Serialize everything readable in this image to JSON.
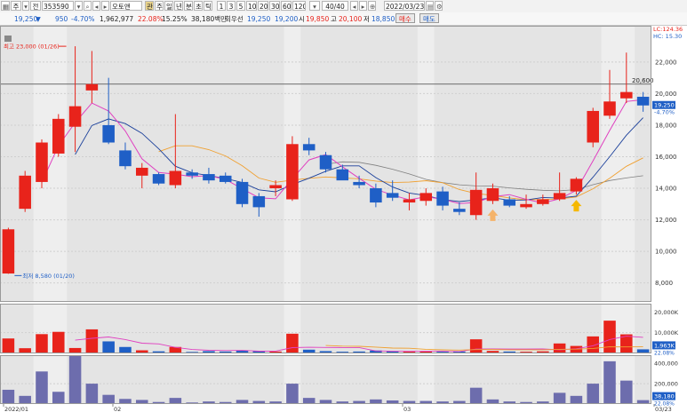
{
  "toolbar": {
    "mode1": "주",
    "mode2": "전",
    "code": "353590",
    "name": "오토앤",
    "tags": [
      "관",
      "주",
      "일",
      "년",
      "분",
      "초",
      "틱"
    ],
    "intervals": [
      "1",
      "3",
      "5",
      "10",
      "20",
      "30",
      "60",
      "120"
    ],
    "count": "40/40",
    "date": "2022/03/23"
  },
  "infobar": {
    "price": "19,250",
    "change": "950",
    "change_pct": "-4.70%",
    "volume": "1,962,977",
    "vol_ratio": "22.08%",
    "turnover": "15.25%",
    "amount": "38,180백만",
    "right_label": "회우선",
    "prev_price": "19,250",
    "prev2": "19,200",
    "open_label": "시",
    "open": "19,850",
    "high_label": "고",
    "high": "20,100",
    "low_label": "저",
    "low": "18,850",
    "buy": "매수",
    "sell": "매도"
  },
  "annotations": {
    "high_marker": "최고 23,000 (01/26)",
    "low_marker": "최저 8,580 (01/20)",
    "ref_line": "20,600",
    "legend1": "LC:124.36",
    "legend2": "HC: 15.30",
    "price_tag": "19,250",
    "price_pct": "-4.70%",
    "vol_tag": "1,963K",
    "vol_pct": "22.08%",
    "amt_tag": "38,180",
    "amt_pct": "22.08%"
  },
  "chart_data": {
    "type": "candlestick",
    "x_labels": [
      "2022/01",
      "02",
      "03",
      "03/23"
    ],
    "price_ticks": [
      8000,
      10000,
      12000,
      14000,
      16000,
      18000,
      20000,
      22000
    ],
    "price_ylim": [
      6800,
      24300
    ],
    "volume_ticks": [
      "10,000K",
      "20,000K"
    ],
    "volume_ylim": [
      0,
      24000
    ],
    "amount_ticks": [
      "200,000",
      "400,000"
    ],
    "amount_ylim": [
      0,
      480000
    ],
    "candles": [
      {
        "o": 8600,
        "h": 11500,
        "l": 8580,
        "c": 11400,
        "v": 7200,
        "a": 140000
      },
      {
        "o": 12700,
        "h": 15100,
        "l": 12500,
        "c": 14800,
        "v": 2500,
        "a": 80000
      },
      {
        "o": 14400,
        "h": 17100,
        "l": 14000,
        "c": 16900,
        "v": 9300,
        "a": 320000
      },
      {
        "o": 16200,
        "h": 18700,
        "l": 16000,
        "c": 18400,
        "v": 10400,
        "a": 120000
      },
      {
        "o": 17900,
        "h": 23000,
        "l": 16300,
        "c": 19200,
        "v": 2600,
        "a": 480000
      },
      {
        "o": 20200,
        "h": 22700,
        "l": 19400,
        "c": 20600,
        "v": 11600,
        "a": 200000
      },
      {
        "o": 18000,
        "h": 21000,
        "l": 16800,
        "c": 16900,
        "v": 5800,
        "a": 90000
      },
      {
        "o": 16400,
        "h": 16900,
        "l": 15200,
        "c": 15400,
        "v": 3100,
        "a": 50000
      },
      {
        "o": 14800,
        "h": 15600,
        "l": 14000,
        "c": 15300,
        "v": 1500,
        "a": 40000
      },
      {
        "o": 14900,
        "h": 15000,
        "l": 14200,
        "c": 14300,
        "v": 1000,
        "a": 20000
      },
      {
        "o": 14200,
        "h": 18700,
        "l": 14000,
        "c": 15100,
        "v": 3100,
        "a": 60000
      },
      {
        "o": 15000,
        "h": 15200,
        "l": 14600,
        "c": 14800,
        "v": 700,
        "a": 15000
      },
      {
        "o": 14900,
        "h": 15300,
        "l": 14300,
        "c": 14500,
        "v": 1100,
        "a": 25000
      },
      {
        "o": 14800,
        "h": 15000,
        "l": 14300,
        "c": 14400,
        "v": 900,
        "a": 20000
      },
      {
        "o": 14400,
        "h": 14600,
        "l": 12800,
        "c": 13000,
        "v": 1500,
        "a": 40000
      },
      {
        "o": 13500,
        "h": 13700,
        "l": 12200,
        "c": 12800,
        "v": 1100,
        "a": 30000
      },
      {
        "o": 14000,
        "h": 14500,
        "l": 13500,
        "c": 14200,
        "v": 900,
        "a": 25000
      },
      {
        "o": 13300,
        "h": 17300,
        "l": 13200,
        "c": 16800,
        "v": 9500,
        "a": 200000
      },
      {
        "o": 16800,
        "h": 17200,
        "l": 16100,
        "c": 16400,
        "v": 1800,
        "a": 60000
      },
      {
        "o": 16100,
        "h": 16300,
        "l": 15000,
        "c": 15200,
        "v": 1100,
        "a": 40000
      },
      {
        "o": 15200,
        "h": 15500,
        "l": 14600,
        "c": 14500,
        "v": 800,
        "a": 25000
      },
      {
        "o": 14400,
        "h": 14800,
        "l": 14000,
        "c": 14200,
        "v": 900,
        "a": 30000
      },
      {
        "o": 14000,
        "h": 14300,
        "l": 12800,
        "c": 13100,
        "v": 1400,
        "a": 45000
      },
      {
        "o": 13700,
        "h": 14500,
        "l": 13200,
        "c": 13400,
        "v": 1000,
        "a": 35000
      },
      {
        "o": 13100,
        "h": 13700,
        "l": 12600,
        "c": 13300,
        "v": 900,
        "a": 30000
      },
      {
        "o": 13200,
        "h": 14000,
        "l": 12900,
        "c": 13700,
        "v": 1000,
        "a": 30000
      },
      {
        "o": 13800,
        "h": 14100,
        "l": 12600,
        "c": 12900,
        "v": 800,
        "a": 25000
      },
      {
        "o": 12700,
        "h": 13100,
        "l": 12300,
        "c": 12500,
        "v": 900,
        "a": 30000
      },
      {
        "o": 12300,
        "h": 15000,
        "l": 12000,
        "c": 13900,
        "v": 6800,
        "a": 160000
      },
      {
        "o": 13200,
        "h": 14300,
        "l": 13000,
        "c": 14000,
        "v": 1200,
        "a": 45000
      },
      {
        "o": 13300,
        "h": 13500,
        "l": 12800,
        "c": 12900,
        "v": 900,
        "a": 25000
      },
      {
        "o": 12800,
        "h": 13600,
        "l": 12700,
        "c": 13000,
        "v": 800,
        "a": 20000
      },
      {
        "o": 13000,
        "h": 13600,
        "l": 12900,
        "c": 13300,
        "v": 1000,
        "a": 25000
      },
      {
        "o": 13300,
        "h": 15000,
        "l": 13200,
        "c": 13700,
        "v": 4800,
        "a": 110000
      },
      {
        "o": 13800,
        "h": 14700,
        "l": 13600,
        "c": 14600,
        "v": 3600,
        "a": 80000
      },
      {
        "o": 16900,
        "h": 19100,
        "l": 16600,
        "c": 18900,
        "v": 8200,
        "a": 200000
      },
      {
        "o": 18600,
        "h": 21500,
        "l": 18400,
        "c": 19500,
        "v": 15800,
        "a": 420000
      },
      {
        "o": 19700,
        "h": 22600,
        "l": 19400,
        "c": 20100,
        "v": 9200,
        "a": 230000
      },
      {
        "o": 19800,
        "h": 20100,
        "l": 18850,
        "c": 19250,
        "v": 1963,
        "a": 38180
      }
    ],
    "markers": [
      {
        "index": 29,
        "color": "#f5b36a"
      },
      {
        "index": 34,
        "color": "#f5b800"
      }
    ],
    "highlight_bands": [
      {
        "from": 2,
        "to": 3
      },
      {
        "from": 17,
        "to": 17
      },
      {
        "from": 25,
        "to": 25
      },
      {
        "from": 36,
        "to": 37
      }
    ]
  },
  "colors": {
    "up": "#e8231b",
    "down": "#1f5fc6",
    "ma_magenta": "#e040c0",
    "ma_navy": "#1a3f9a",
    "ma_orange": "#f0a030",
    "ma_red": "#e03030",
    "ma_gray": "#808080",
    "amount_bar": "#6d6dad"
  }
}
